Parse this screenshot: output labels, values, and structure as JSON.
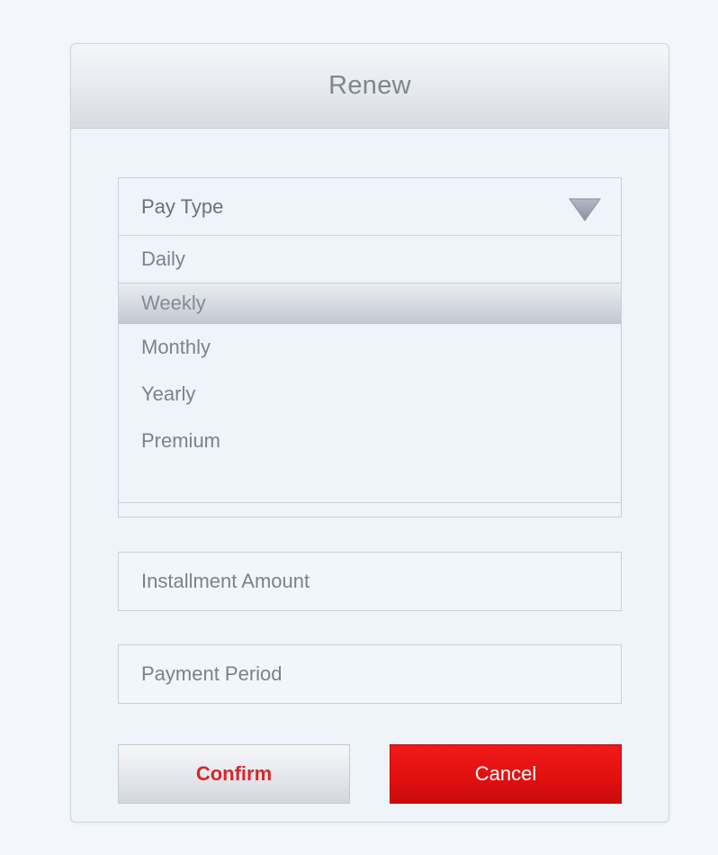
{
  "dialog": {
    "title": "Renew"
  },
  "pay_type": {
    "label": "Pay Type",
    "icon": "chevron-down-icon",
    "options": [
      {
        "label": "Daily",
        "selected": false
      },
      {
        "label": "Weekly",
        "selected": true
      },
      {
        "label": "Monthly",
        "selected": false
      },
      {
        "label": "Yearly",
        "selected": false
      },
      {
        "label": "Premium",
        "selected": false
      }
    ]
  },
  "fields": {
    "installment_placeholder": "Installment Amount",
    "period_placeholder": "Payment Period"
  },
  "buttons": {
    "confirm_label": "Confirm",
    "cancel_label": "Cancel"
  },
  "colors": {
    "accent": "#e10f10",
    "confirm_text": "#d8262a",
    "background": "#eef4fa"
  }
}
